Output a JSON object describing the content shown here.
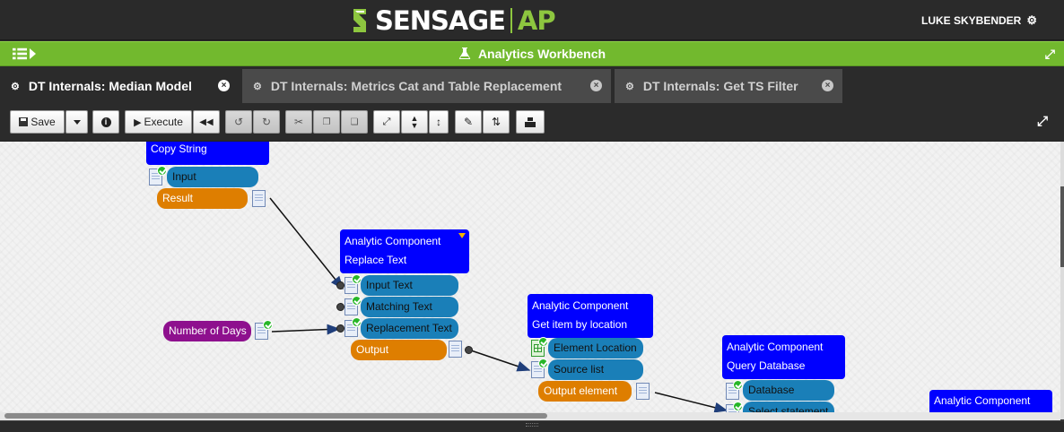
{
  "app": {
    "brand": "SENSAGE",
    "brand_suffix": "AP",
    "user": "LUKE SKYBENDER",
    "accent": "#72b92e",
    "brand_green": "#8dc63f"
  },
  "workbench": {
    "title": "Analytics Workbench"
  },
  "tabs": [
    {
      "label": "DT Internals: Median Model",
      "active": true
    },
    {
      "label": "DT Internals: Metrics Cat and Table Replacement",
      "active": false
    },
    {
      "label": "DT Internals: Get TS Filter",
      "active": false
    }
  ],
  "toolbar": {
    "save_label": "Save",
    "execute_label": "Execute",
    "icons": [
      "save-icon",
      "dropdown-caret-icon",
      "info-icon",
      "play-icon",
      "rewind-icon",
      "undo-icon",
      "redo-icon",
      "cut-icon",
      "copy-icon",
      "paste-icon",
      "shrink-icon",
      "vertical-expand-icon",
      "vertical-arrow-icon",
      "edit-icon",
      "swap-icon",
      "print-icon",
      "fullscreen-icon"
    ]
  },
  "canvas": {
    "nodes": [
      {
        "id": "copy-string",
        "title_lines": [
          "Copy String"
        ],
        "inputs": [
          "Input"
        ],
        "outputs": [
          "Result"
        ]
      },
      {
        "id": "replace-text",
        "title_lines": [
          "Analytic Component",
          "Replace Text"
        ],
        "inputs": [
          "Input Text",
          "Matching Text",
          "Replacement Text"
        ],
        "outputs": [
          "Output"
        ]
      },
      {
        "id": "get-item",
        "title_lines": [
          "Analytic Component",
          "Get item by location"
        ],
        "inputs": [
          "Element Location",
          "Source list"
        ],
        "outputs": [
          "Output element"
        ]
      },
      {
        "id": "query-database",
        "title_lines": [
          "Analytic Component",
          "Query Database"
        ],
        "inputs": [
          "Database",
          "Select statement"
        ],
        "outputs": []
      },
      {
        "id": "partial-node",
        "title_lines": [
          "Analytic Component"
        ],
        "inputs": [],
        "outputs": []
      }
    ],
    "parameters": [
      {
        "label": "Number of Days"
      }
    ],
    "colors": {
      "node_header": "#0000ff",
      "input_port": "#1a7fb8",
      "output_port": "#de7e00",
      "parameter": "#8e108e"
    }
  }
}
